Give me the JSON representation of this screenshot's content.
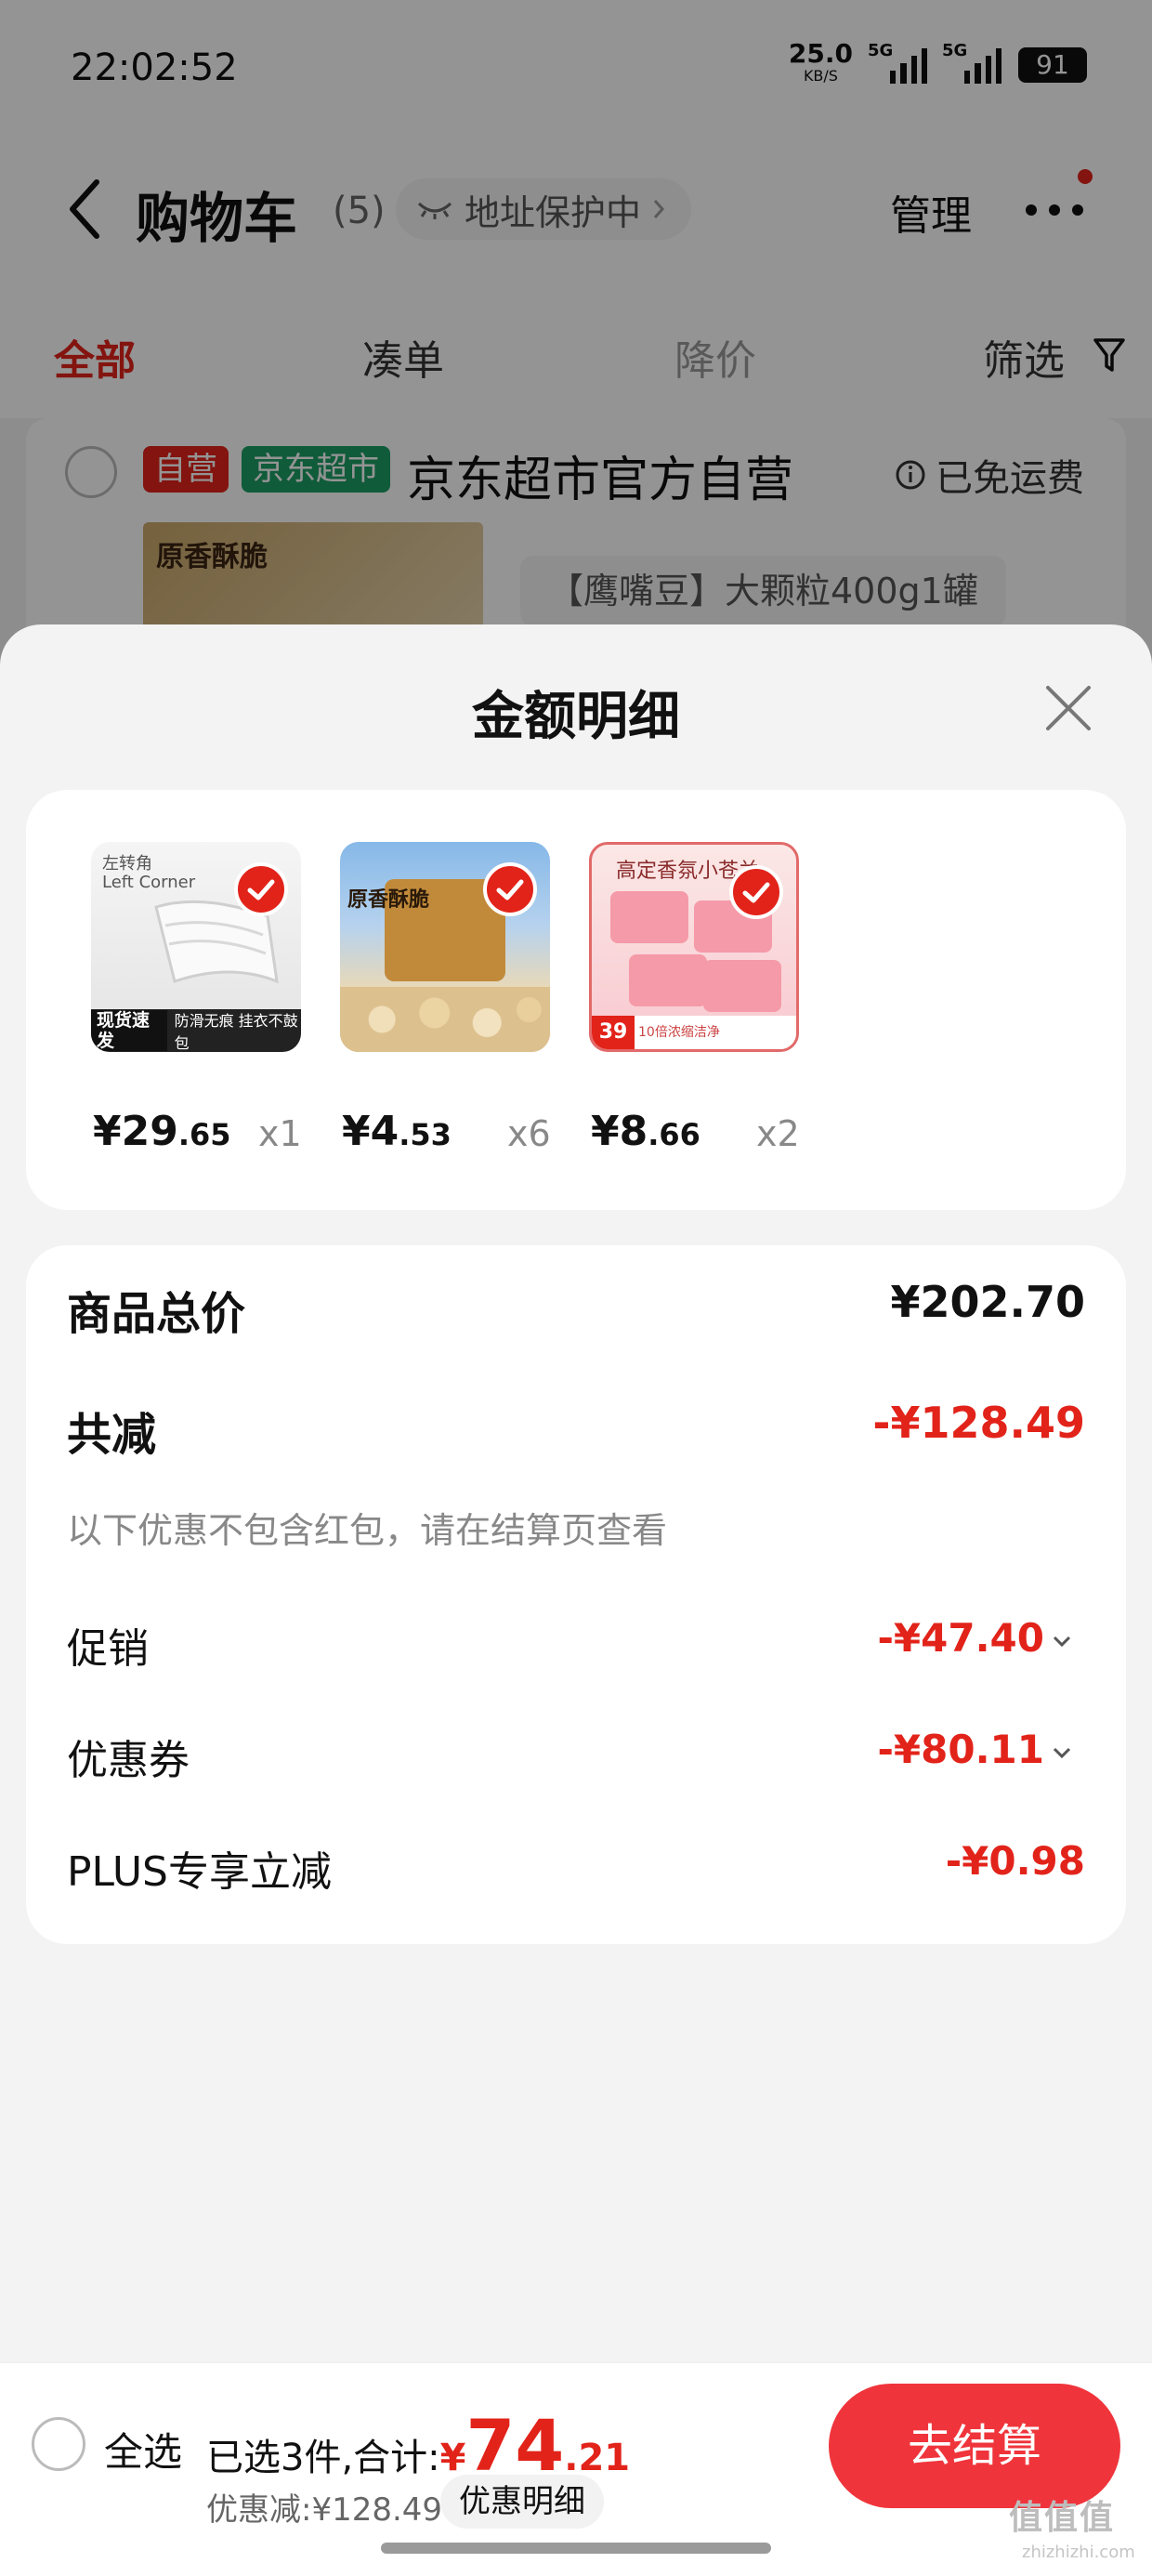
{
  "status_bar": {
    "time": "22:02:52",
    "net_speed_value": "25.0",
    "net_speed_unit": "KB/S",
    "signal_1": "5G",
    "signal_2": "5G",
    "battery": "91"
  },
  "nav": {
    "title": "购物车",
    "count": "(5)",
    "address_protect": "地址保护中",
    "manage": "管理"
  },
  "tabs": [
    {
      "label": "全部",
      "active": true
    },
    {
      "label": "凑单"
    },
    {
      "label": "降价"
    },
    {
      "label": "筛选"
    }
  ],
  "shop": {
    "badge_self": "自营",
    "badge_market": "京东超市",
    "name": "京东超市官方自营",
    "free_shipping": "已免运费",
    "product_thumb_text": "原香酥脆",
    "variant": "【鹰嘴豆】大颗粒400g1罐"
  },
  "sheet": {
    "title": "金额明细",
    "items": [
      {
        "price_int": "¥29",
        "price_dec": ".65",
        "qty": "x1",
        "thumb": "clothes-hanger",
        "thumb_brand": "左转角",
        "thumb_brand_en": "Left Corner",
        "thumb_tag": "现货速发",
        "thumb_caption": "防滑无痕 挂衣不鼓包"
      },
      {
        "price_int": "¥4",
        "price_dec": ".53",
        "qty": "x6",
        "thumb": "chickpeas-jar",
        "thumb_label": "原香酥脆"
      },
      {
        "price_int": "¥8",
        "price_dec": ".66",
        "qty": "x2",
        "thumb": "laundry-pods",
        "thumb_header": "高定香氛小苍兰",
        "thumb_price": "39",
        "thumb_caption": "10倍浓缩洁净"
      }
    ],
    "summary": {
      "goods_total_label": "商品总价",
      "goods_total_value": "¥202.70",
      "reduction_label": "共减",
      "reduction_value": "-¥128.49",
      "note": "以下优惠不包含红包，请在结算页查看",
      "promo_label": "促销",
      "promo_value": "-¥47.40",
      "coupon_label": "优惠券",
      "coupon_value": "-¥80.11",
      "plus_label": "PLUS专享立减",
      "plus_value": "-¥0.98"
    }
  },
  "bottom_bar": {
    "select_all": "全选",
    "selected_prefix": "已选3件,合计:",
    "total_yen": "¥",
    "total_int": "74",
    "total_dec": ".21",
    "discount": "优惠减:¥128.49",
    "detail_button": "优惠明细",
    "checkout": "去结算"
  },
  "watermark": "值值值",
  "watermark_sub": "zhizhizhi.com",
  "colors": {
    "accent_red": "#e2231a",
    "checkout_red": "#f0343b",
    "market_green": "#1c9e64"
  }
}
